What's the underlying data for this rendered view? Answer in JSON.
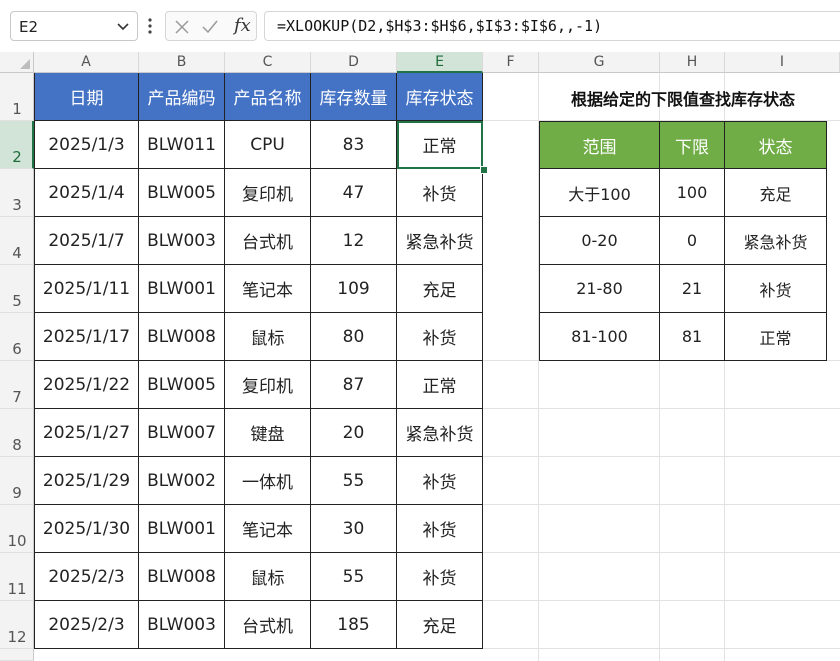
{
  "name_box": "E2",
  "formula": "=XLOOKUP(D2,$H$3:$H$6,$I$3:$I$6,,-1)",
  "formula_buttons": {
    "fx": "fx"
  },
  "icons": {
    "chevron": "chevron-down-icon",
    "more": "more-vert-icon",
    "cancel": "cancel-x-icon",
    "enter": "checkmark-icon"
  },
  "colors": {
    "header_blue": "#4472c4",
    "header_green": "#70ad47",
    "selection": "#217346"
  },
  "columns": [
    "A",
    "B",
    "C",
    "D",
    "E",
    "F",
    "G",
    "H",
    "I"
  ],
  "rows": [
    "1",
    "2",
    "3",
    "4",
    "5",
    "6",
    "7",
    "8",
    "9",
    "10",
    "11",
    "12"
  ],
  "selected_cell": "E2",
  "main_table": {
    "headers": [
      "日期",
      "产品编码",
      "产品名称",
      "库存数量",
      "库存状态"
    ],
    "rows": [
      [
        "2025/1/3",
        "BLW011",
        "CPU",
        "83",
        "正常"
      ],
      [
        "2025/1/4",
        "BLW005",
        "复印机",
        "47",
        "补货"
      ],
      [
        "2025/1/7",
        "BLW003",
        "台式机",
        "12",
        "紧急补货"
      ],
      [
        "2025/1/11",
        "BLW001",
        "笔记本",
        "109",
        "充足"
      ],
      [
        "2025/1/17",
        "BLW008",
        "鼠标",
        "80",
        "补货"
      ],
      [
        "2025/1/22",
        "BLW005",
        "复印机",
        "87",
        "正常"
      ],
      [
        "2025/1/27",
        "BLW007",
        "键盘",
        "20",
        "紧急补货"
      ],
      [
        "2025/1/29",
        "BLW002",
        "一体机",
        "55",
        "补货"
      ],
      [
        "2025/1/30",
        "BLW001",
        "笔记本",
        "30",
        "补货"
      ],
      [
        "2025/2/3",
        "BLW008",
        "鼠标",
        "55",
        "补货"
      ],
      [
        "2025/2/3",
        "BLW003",
        "台式机",
        "185",
        "充足"
      ]
    ]
  },
  "lookup_table": {
    "title": "根据给定的下限值查找库存状态",
    "headers": [
      "范围",
      "下限",
      "状态"
    ],
    "rows": [
      [
        "大于100",
        "100",
        "充足"
      ],
      [
        "0-20",
        "0",
        "紧急补货"
      ],
      [
        "21-80",
        "21",
        "补货"
      ],
      [
        "81-100",
        "81",
        "正常"
      ]
    ]
  }
}
